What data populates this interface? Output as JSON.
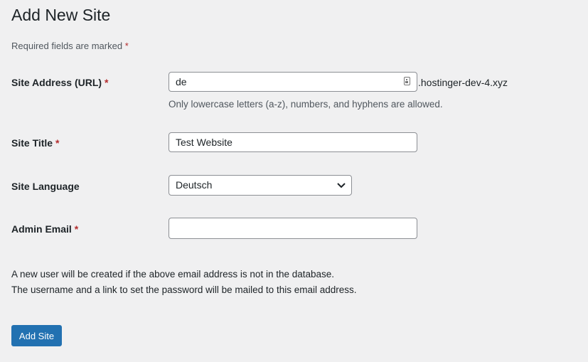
{
  "title": "Add New Site",
  "required_note": "Required fields are marked",
  "asterisk": "*",
  "fields": {
    "address": {
      "label": "Site Address (URL)",
      "value": "de",
      "suffix": ".hostinger-dev-4.xyz",
      "hint": "Only lowercase letters (a-z), numbers, and hyphens are allowed."
    },
    "title": {
      "label": "Site Title",
      "value": "Test Website"
    },
    "language": {
      "label": "Site Language",
      "value": "Deutsch"
    },
    "email": {
      "label": "Admin Email",
      "value": ""
    }
  },
  "note_line1": "A new user will be created if the above email address is not in the database.",
  "note_line2": "The username and a link to set the password will be mailed to this email address.",
  "submit_label": "Add Site"
}
